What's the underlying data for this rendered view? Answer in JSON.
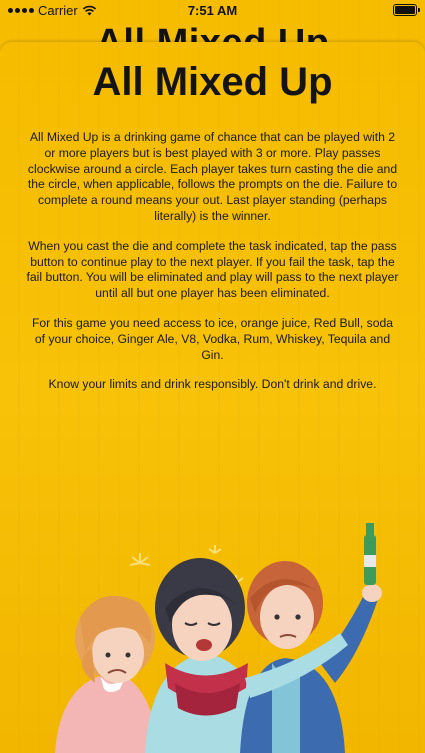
{
  "status_bar": {
    "carrier": "Carrier",
    "time": "7:51 AM"
  },
  "behind_title": "All Mixed Up",
  "title": "All Mixed Up",
  "paragraphs": [
    "All Mixed Up is a drinking game of chance that can be played with 2 or more players but is best played with 3 or more. Play passes clockwise around a circle. Each player takes turn casting the die and the circle, when applicable, follows the prompts on the die. Failure to complete a round means your out. Last player standing (perhaps literally) is the winner.",
    "When you cast the die and complete the task indicated, tap the pass button to continue play to the next player. If you fail the task, tap the fail button. You will be eliminated and play will pass to the next player until all but one player has been eliminated.",
    "For this game you need access to ice, orange juice, Red Bull, soda of your choice, Ginger Ale, V8, Vodka, Rum, Whiskey, Tequila and Gin.",
    "Know your limits and drink responsibly. Don't drink and drive."
  ],
  "colors": {
    "background": "#F5B900",
    "text": "#1a1a1a"
  },
  "icons": {
    "signal": "signal-dots-icon",
    "wifi": "wifi-icon",
    "battery": "battery-icon"
  }
}
